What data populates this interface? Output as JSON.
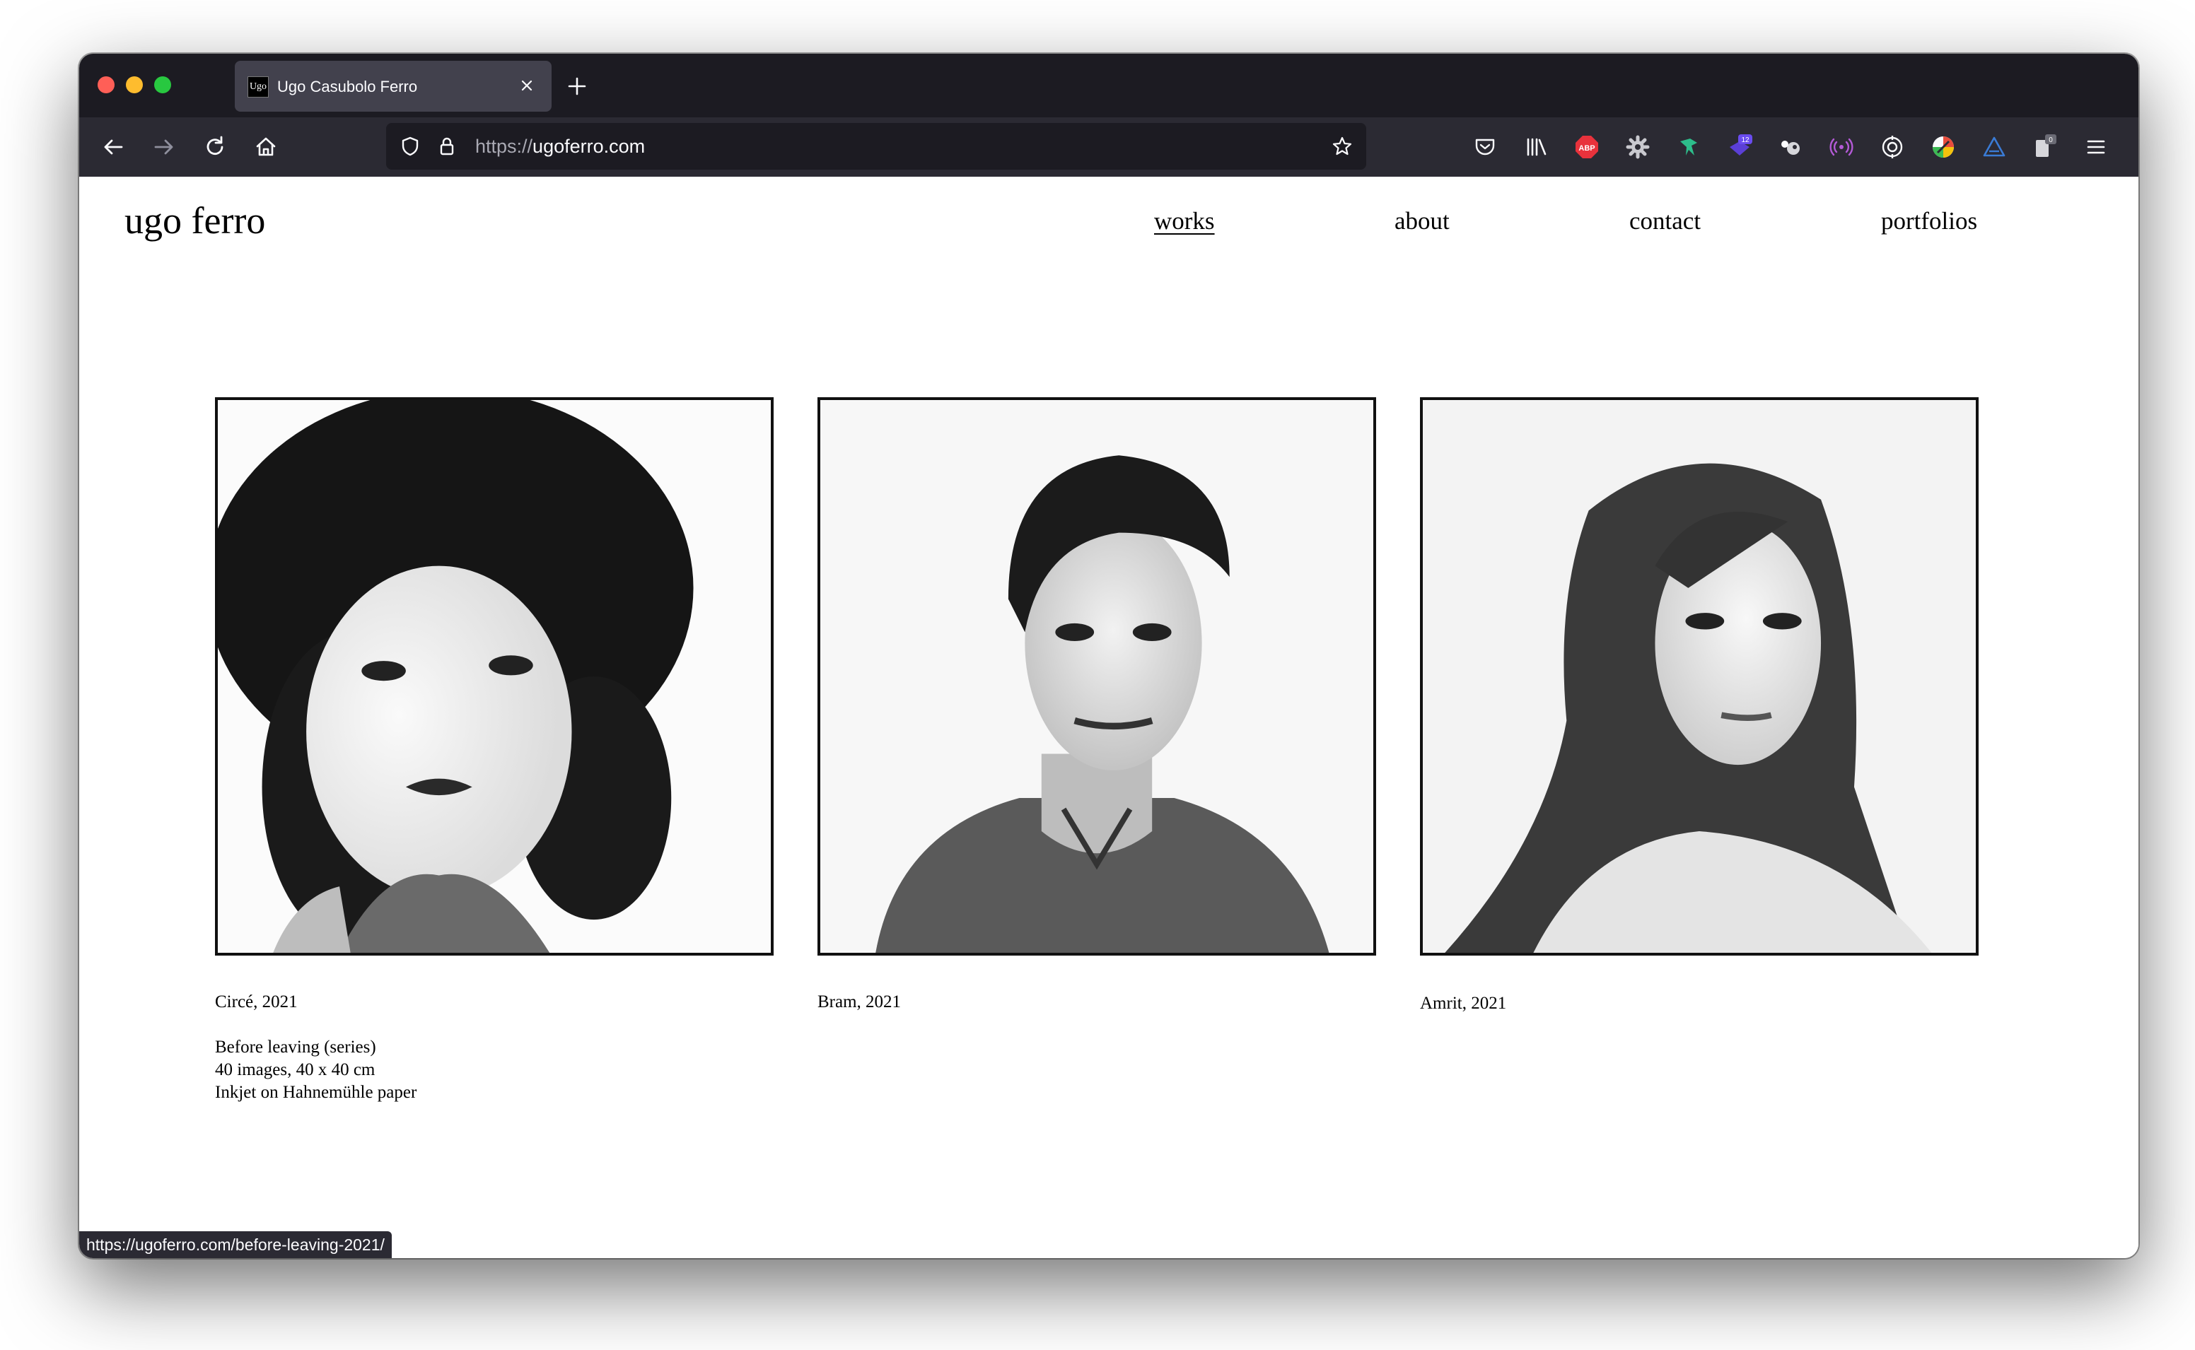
{
  "browser": {
    "tab_title": "Ugo Casubolo Ferro",
    "tab_favicon_text": "Ugo",
    "url_scheme": "https://",
    "url_host": "ugoferro.com",
    "status_url": "https://ugoferro.com/before-leaving-2021/",
    "extensions": [
      {
        "name": "pocket-icon"
      },
      {
        "name": "library-icon"
      },
      {
        "name": "adblock-plus-icon",
        "label": "ABP",
        "color": "#e8323c"
      },
      {
        "name": "gear-extension-icon"
      },
      {
        "name": "bird-extension-icon",
        "color": "#2dbd8b"
      },
      {
        "name": "stack-extension-icon",
        "badge": "12",
        "color": "#5b3fd6"
      },
      {
        "name": "puzzle-extension-icon"
      },
      {
        "name": "broadcast-extension-icon",
        "color": "#b35ad6"
      },
      {
        "name": "target-extension-icon"
      },
      {
        "name": "color-wheel-extension-icon"
      },
      {
        "name": "triangle-extension-icon",
        "color": "#3a7bd5"
      },
      {
        "name": "clipboard-extension-icon",
        "badge": "0"
      },
      {
        "name": "menu-icon"
      }
    ]
  },
  "site": {
    "title": "ugo ferro",
    "nav": [
      {
        "label": "works",
        "active": true
      },
      {
        "label": "about",
        "active": false
      },
      {
        "label": "contact",
        "active": false
      },
      {
        "label": "portfolios",
        "active": false
      }
    ]
  },
  "works": [
    {
      "caption": "Circé, 2021",
      "details": [
        "Before leaving (series)",
        "40 images, 40 x 40 cm",
        "Inkjet on Hahnemühle paper"
      ]
    },
    {
      "caption": "Bram, 2021",
      "details": []
    },
    {
      "caption": "Amrit, 2021",
      "details": []
    }
  ],
  "colors": {
    "tabbar": "#1c1b22",
    "toolbar": "#2b2a33",
    "page_bg": "#ffffff",
    "text": "#000000"
  }
}
